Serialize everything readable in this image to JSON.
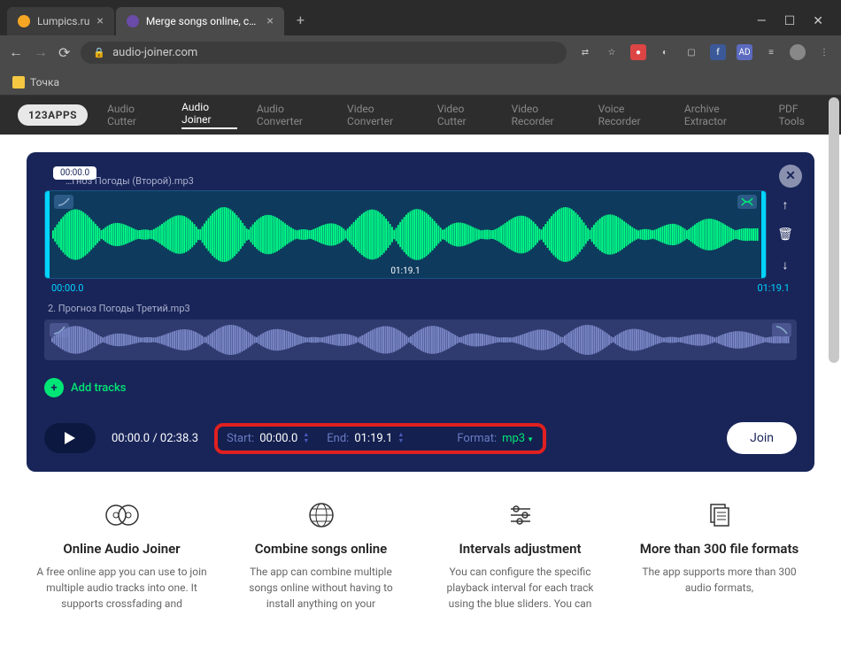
{
  "browser": {
    "tabs": [
      {
        "title": "Lumpics.ru",
        "active": false
      },
      {
        "title": "Merge songs online, combine mp…",
        "active": true
      }
    ],
    "url": "audio-joiner.com",
    "bookmark": "Точка"
  },
  "nav": {
    "logo": "123APPS",
    "items": [
      "Audio Cutter",
      "Audio Joiner",
      "Audio Converter",
      "Video Converter",
      "Video Cutter",
      "Video Recorder",
      "Voice Recorder",
      "Archive Extractor",
      "PDF Tools"
    ],
    "active_index": 1
  },
  "editor": {
    "playhead_badge": "00:00.0",
    "track1": {
      "name": "…гноз Погоды (Второй).mp3",
      "duration_label": "01:19.1",
      "range_start": "00:00.0",
      "range_end": "01:19.1"
    },
    "track2": {
      "name": "2. Прогноз Погоды Третий.mp3"
    },
    "add_tracks_label": "Add tracks",
    "controls": {
      "time_display": "00:00.0 / 02:38.3",
      "start_label": "Start:",
      "start_val": "00:00.0",
      "end_label": "End:",
      "end_val": "01:19.1",
      "format_label": "Format:",
      "format_val": "mp3",
      "join_label": "Join"
    }
  },
  "features": [
    {
      "title": "Online Audio Joiner",
      "desc": "A free online app you can use to join multiple audio tracks into one. It supports crossfading and"
    },
    {
      "title": "Combine songs online",
      "desc": "The app can combine multiple songs online without having to install anything on your"
    },
    {
      "title": "Intervals adjustment",
      "desc": "You can configure the specific playback interval for each track using the blue sliders. You can"
    },
    {
      "title": "More than 300 file formats",
      "desc": "The app supports more than 300 audio formats,"
    }
  ]
}
